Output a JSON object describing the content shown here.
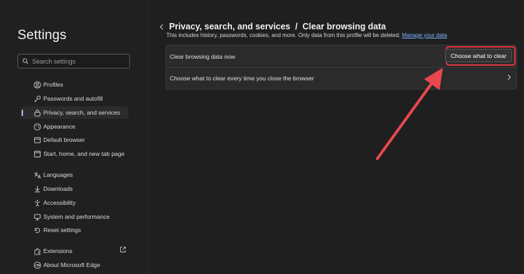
{
  "sidebar": {
    "title": "Settings",
    "search_placeholder": "Search settings",
    "items": [
      {
        "label": "Profiles",
        "icon": "profile-icon"
      },
      {
        "label": "Passwords and autofill",
        "icon": "key-icon"
      },
      {
        "label": "Privacy, search, and services",
        "icon": "lock-icon",
        "active": true
      },
      {
        "label": "Appearance",
        "icon": "appearance-icon"
      },
      {
        "label": "Default browser",
        "icon": "browser-icon"
      },
      {
        "label": "Start, home, and new tab page",
        "icon": "home-icon"
      },
      {
        "label": "Languages",
        "icon": "languages-icon"
      },
      {
        "label": "Downloads",
        "icon": "download-icon"
      },
      {
        "label": "Accessibility",
        "icon": "accessibility-icon"
      },
      {
        "label": "System and performance",
        "icon": "system-icon"
      },
      {
        "label": "Reset settings",
        "icon": "reset-icon"
      },
      {
        "label": "Extensions",
        "icon": "extensions-icon"
      },
      {
        "label": "About Microsoft Edge",
        "icon": "edge-icon"
      }
    ]
  },
  "main": {
    "title": "Privacy, search, and services  /  Clear browsing data",
    "subtitle": "This includes history, passwords, cookies, and more. Only data from this profile will be deleted.",
    "subtitle_link": "Manage your data",
    "rows": [
      {
        "label": "Clear browsing data now",
        "button": "Choose what to clear"
      },
      {
        "label": "Choose what to clear every time you close the browser"
      }
    ]
  },
  "colors": {
    "accent": "#9fc3ff",
    "highlight": "#e0343e",
    "link": "#7cb2ff"
  }
}
